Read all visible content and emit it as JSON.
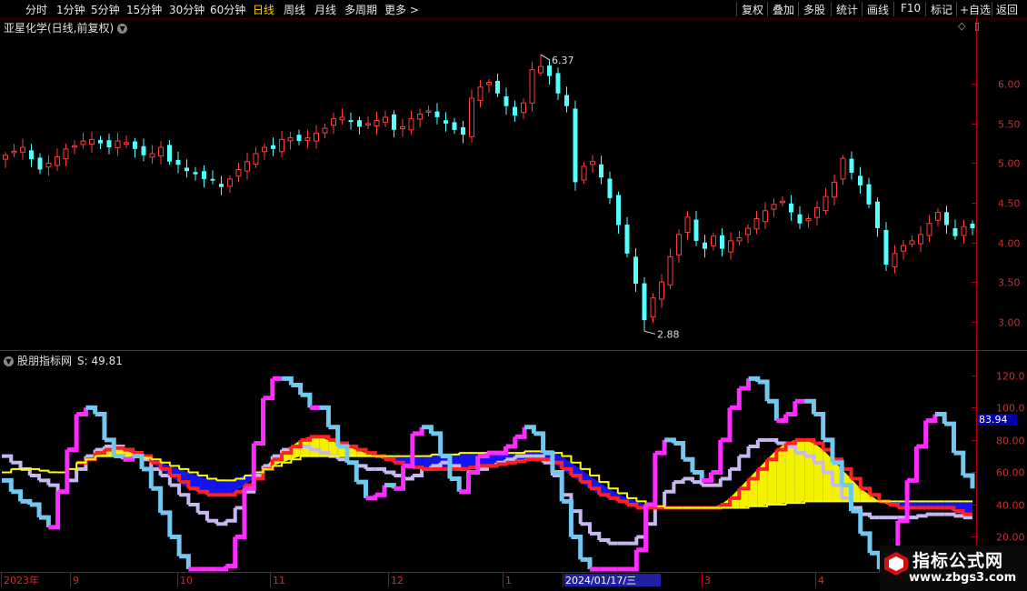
{
  "toolbar": {
    "periods": [
      "分时",
      "1分钟",
      "5分钟",
      "15分钟",
      "30分钟",
      "60分钟",
      "日线",
      "周线",
      "月线",
      "多周期",
      "更多 >"
    ],
    "active": "日线",
    "right_items": [
      "复权",
      "叠加",
      "多股",
      "统计",
      "画线",
      "F10",
      "标记",
      "+自选",
      "返回"
    ]
  },
  "stock": {
    "title": "亚星化学(日线,前复权)",
    "high_label": "6.37",
    "low_label": "2.88"
  },
  "indicator": {
    "title": "股朋指标网",
    "value_label": "S: 49.81",
    "current_value_box": "83.94"
  },
  "logo": {
    "line1": "指标公式网",
    "line2": "www.zbgs3.com"
  },
  "colors": {
    "up": "#ff3b3b",
    "down": "#54ffff",
    "axis": "#c00000",
    "grid": "#800000",
    "tick_text": "#c83030",
    "magenta": "#ff2cff",
    "lightblue": "#73c8f0",
    "lavender": "#c8b8f0",
    "yellow": "#ffff00",
    "blue": "#1515ff",
    "red": "#ff2020"
  },
  "chart_data": [
    {
      "type": "candlestick",
      "title": "亚星化学(日线,前复权)",
      "ylim": [
        2.7,
        6.6
      ],
      "y_ticks": [
        "6.00",
        "5.50",
        "5.00",
        "4.50",
        "4.00",
        "3.50",
        "3.00"
      ],
      "annotations": [
        {
          "text": "6.37",
          "value": 6.37
        },
        {
          "text": "2.88",
          "value": 2.88
        }
      ],
      "closes": [
        5.1,
        5.15,
        5.2,
        5.05,
        4.92,
        5.0,
        5.08,
        5.18,
        5.22,
        5.28,
        5.3,
        5.25,
        5.2,
        5.28,
        5.26,
        5.18,
        5.1,
        5.12,
        5.2,
        5.02,
        4.98,
        4.9,
        4.86,
        4.8,
        4.78,
        4.7,
        4.8,
        4.92,
        5.02,
        5.12,
        5.2,
        5.18,
        5.3,
        5.32,
        5.28,
        5.32,
        5.38,
        5.44,
        5.56,
        5.58,
        5.52,
        5.46,
        5.5,
        5.54,
        5.58,
        5.42,
        5.46,
        5.56,
        5.62,
        5.66,
        5.58,
        5.5,
        5.42,
        5.36,
        5.82,
        5.96,
        6.02,
        5.88,
        5.72,
        5.6,
        5.76,
        6.18,
        6.22,
        6.1,
        5.88,
        5.72,
        4.76,
        4.96,
        5.02,
        4.82,
        4.56,
        4.22,
        3.86,
        3.48,
        3.02,
        3.3,
        3.5,
        3.82,
        4.1,
        4.32,
        4.02,
        3.92,
        4.08,
        3.92,
        4.02,
        4.06,
        4.18,
        4.3,
        4.4,
        4.48,
        4.52,
        4.38,
        4.24,
        4.3,
        4.44,
        4.58,
        4.76,
        5.06,
        4.88,
        4.72,
        4.48,
        4.18,
        3.72,
        3.86,
        3.96,
        4.02,
        4.1,
        4.24,
        4.38,
        4.22,
        4.08,
        4.2,
        4.18
      ],
      "volume_drawn": false
    },
    {
      "type": "line",
      "title": "股朋指标网",
      "ylim": [
        0,
        125
      ],
      "y_ticks": [
        "120.0",
        "100.0",
        "80.00",
        "60.00",
        "40.00",
        "20.00"
      ],
      "x_tick_labels": [
        "2023年",
        "9",
        "10",
        "11",
        "12",
        "1",
        "2024/01/17/三",
        "3",
        "4"
      ],
      "series": [
        {
          "values": [
            55,
            48,
            42,
            40,
            32,
            26,
            48,
            74,
            96,
            100,
            96,
            80,
            70,
            68,
            70,
            62,
            50,
            35,
            20,
            8,
            0,
            0,
            0,
            0,
            2,
            20,
            50,
            78,
            106,
            118,
            118,
            114,
            108,
            100,
            100,
            88,
            76,
            66,
            54,
            44,
            46,
            52,
            50,
            64,
            84,
            88,
            84,
            70,
            56,
            48,
            60,
            70,
            72,
            72,
            76,
            82,
            88,
            84,
            72,
            60,
            42,
            20,
            6,
            0,
            0,
            0,
            0,
            0,
            12,
            40,
            72,
            80,
            78,
            68,
            60,
            55,
            60,
            80,
            100,
            112,
            118,
            116,
            104,
            92,
            96,
            104,
            104,
            96,
            80,
            66,
            52,
            36,
            22,
            10,
            0,
            10,
            30,
            55,
            76,
            92,
            96,
            90,
            72,
            58,
            50
          ]
        },
        {
          "values": [
            70,
            66,
            62,
            58,
            55,
            52,
            48,
            55,
            62,
            70,
            74,
            76,
            76,
            74,
            72,
            68,
            62,
            58,
            52,
            46,
            40,
            35,
            30,
            28,
            30,
            38,
            48,
            58,
            64,
            70,
            74,
            76,
            76,
            74,
            72,
            70,
            68,
            66,
            64,
            62,
            62,
            60,
            58,
            56,
            58,
            62,
            64,
            66,
            64,
            62,
            60,
            62,
            64,
            66,
            68,
            70,
            70,
            70,
            66,
            58,
            46,
            36,
            28,
            22,
            18,
            16,
            16,
            16,
            20,
            28,
            38,
            48,
            54,
            56,
            54,
            52,
            52,
            56,
            62,
            70,
            76,
            80,
            80,
            78,
            76,
            72,
            70,
            66,
            60,
            52,
            44,
            38,
            34,
            32,
            32,
            32,
            32,
            32,
            33,
            34,
            34,
            34,
            33,
            32,
            32
          ]
        },
        {
          "values": [
            null,
            null,
            null,
            null,
            null,
            null,
            null,
            null,
            66,
            68,
            72,
            74,
            75,
            74,
            72,
            70,
            66,
            62,
            58,
            54,
            50,
            48,
            46,
            46,
            46,
            48,
            52,
            56,
            62,
            68,
            72,
            76,
            80,
            82,
            82,
            80,
            78,
            76,
            74,
            72,
            70,
            68,
            66,
            64,
            63,
            62,
            62,
            62,
            62,
            62,
            63,
            64,
            64,
            65,
            66,
            67,
            68,
            68,
            68,
            66,
            62,
            58,
            54,
            50,
            46,
            44,
            42,
            40,
            38,
            38,
            38,
            38,
            38,
            38,
            38,
            38,
            38,
            40,
            44,
            50,
            56,
            62,
            68,
            74,
            78,
            80,
            80,
            78,
            74,
            68,
            62,
            56,
            50,
            46,
            42,
            40,
            38,
            38,
            38,
            38,
            38,
            38,
            36,
            34,
            34
          ]
        },
        {
          "values": [
            60,
            62,
            62,
            62,
            61,
            60,
            60,
            62,
            66,
            68,
            70,
            70,
            70,
            70,
            70,
            69,
            68,
            66,
            64,
            62,
            60,
            58,
            56,
            55,
            55,
            56,
            58,
            60,
            62,
            64,
            66,
            68,
            70,
            70,
            70,
            70,
            70,
            70,
            70,
            70,
            70,
            70,
            70,
            70,
            70,
            70,
            71,
            71,
            71,
            72,
            72,
            72,
            72,
            72,
            72,
            72,
            73,
            73,
            73,
            72,
            70,
            66,
            62,
            58,
            54,
            50,
            47,
            44,
            42,
            40,
            39,
            38,
            38,
            38,
            38,
            38,
            38,
            38,
            38,
            38,
            39,
            39,
            40,
            40,
            41,
            41,
            42,
            42,
            42,
            42,
            42,
            42,
            42,
            42,
            42,
            42,
            42,
            42,
            42,
            42,
            42,
            42,
            42,
            42,
            42
          ]
        }
      ]
    }
  ]
}
